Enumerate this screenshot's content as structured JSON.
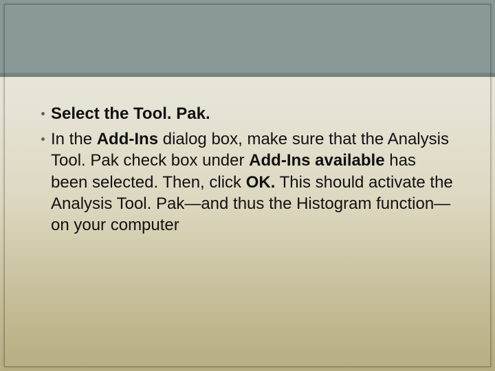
{
  "bullets": [
    {
      "segments": [
        {
          "text": "Select the Tool. Pak.",
          "bold": true
        }
      ]
    },
    {
      "segments": [
        {
          "text": "In the ",
          "bold": false
        },
        {
          "text": "Add-Ins",
          "bold": true
        },
        {
          "text": " dialog box, make sure that the Analysis Tool. Pak check box under ",
          "bold": false
        },
        {
          "text": "Add-Ins available",
          "bold": true
        },
        {
          "text": " has been selected. Then, click ",
          "bold": false
        },
        {
          "text": "OK.",
          "bold": true
        },
        {
          "text": " This should activate the Analysis Tool. Pak—and thus the Histogram function—on your computer",
          "bold": false
        }
      ]
    }
  ]
}
